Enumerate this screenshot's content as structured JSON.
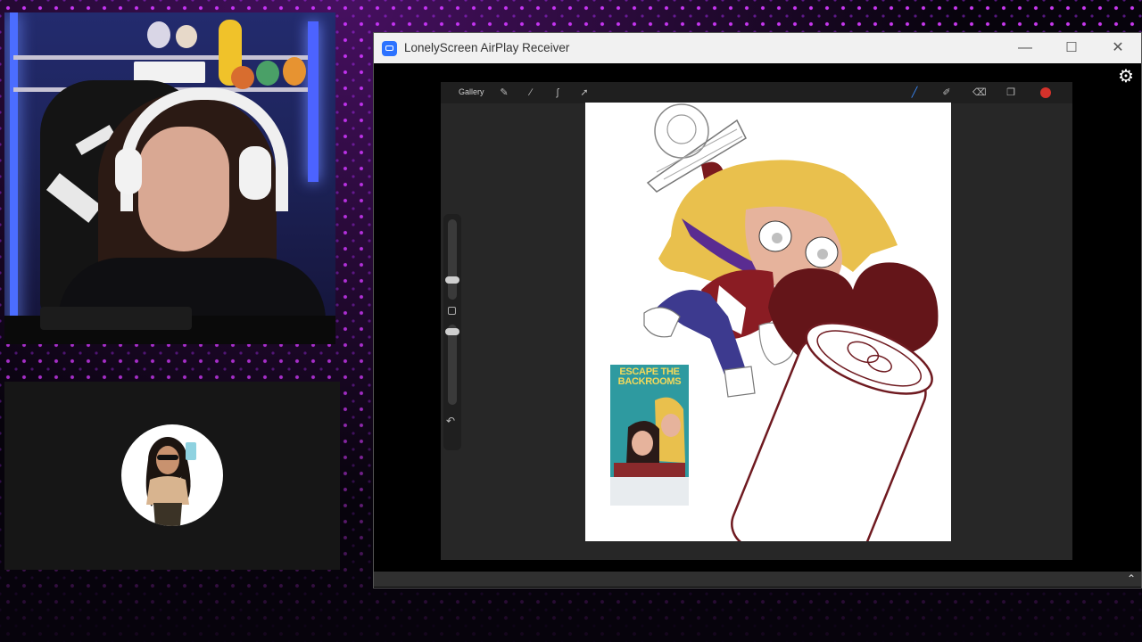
{
  "window": {
    "title": "LonelyScreen AirPlay Receiver",
    "minimize_glyph": "—",
    "maximize_glyph": "☐",
    "close_glyph": "✕"
  },
  "procreate": {
    "gallery_label": "Gallery",
    "current_color": "#d4322b",
    "artwork_poster_text": "ESCAPE THE BACKROOMS"
  },
  "icons": {
    "settings": "gear-icon",
    "scroll_up": "chevron-up-icon",
    "undo": "undo-icon"
  },
  "colors": {
    "background_accent": "#c83cff",
    "titlebar": "#f1f1f1",
    "app_icon": "#2c72ff"
  }
}
